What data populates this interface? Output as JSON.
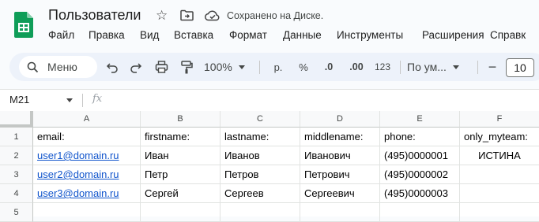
{
  "app": {
    "title": "Пользователи",
    "save_status": "Сохранено на Диске."
  },
  "menu": [
    "Файл",
    "Правка",
    "Вид",
    "Вставка",
    "Формат",
    "Данные",
    "Инструменты",
    "Расширения",
    "Справк"
  ],
  "toolbar": {
    "search_label": "Меню",
    "zoom": "100%",
    "currency": "р.",
    "percent": "%",
    "decrease_decimals": ".0",
    "increase_decimals": ".00",
    "number_format": "123",
    "font_family": "По ум...",
    "font_size": "10",
    "minus": "−"
  },
  "formula_bar": {
    "name_box": "M21",
    "fx": "fx",
    "value": ""
  },
  "sheet": {
    "columns": [
      "A",
      "B",
      "C",
      "D",
      "E",
      "F"
    ],
    "row_numbers": [
      "1",
      "2",
      "3",
      "4",
      "5"
    ],
    "rows": [
      [
        "email:",
        "firstname:",
        "lastname:",
        "middlename:",
        "phone:",
        "only_myteam:"
      ],
      [
        "user1@domain.ru",
        "Иван",
        "Иванов",
        "Иванович",
        "(495)0000001",
        "ИСТИНА"
      ],
      [
        "user2@domain.ru",
        "Петр",
        "Петров",
        "Петрович",
        "(495)0000002",
        ""
      ],
      [
        "user3@domain.ru",
        "Сергей",
        "Сергеев",
        "Сергеевич",
        "(495)0000003",
        ""
      ],
      [
        "",
        "",
        "",
        "",
        "",
        ""
      ]
    ]
  },
  "colors": {
    "accent": "#0b57d0",
    "sheets_green": "#0f9d58",
    "link": "#1155cc",
    "toolbar_bg": "#edf2fa"
  },
  "icons": [
    "sheets-logo-icon",
    "star-icon",
    "move-folder-icon",
    "cloud-saved-icon",
    "search-icon",
    "undo-icon",
    "redo-icon",
    "print-icon",
    "paint-format-icon",
    "zoom-dropdown-icon",
    "name-box-dropdown-icon"
  ]
}
